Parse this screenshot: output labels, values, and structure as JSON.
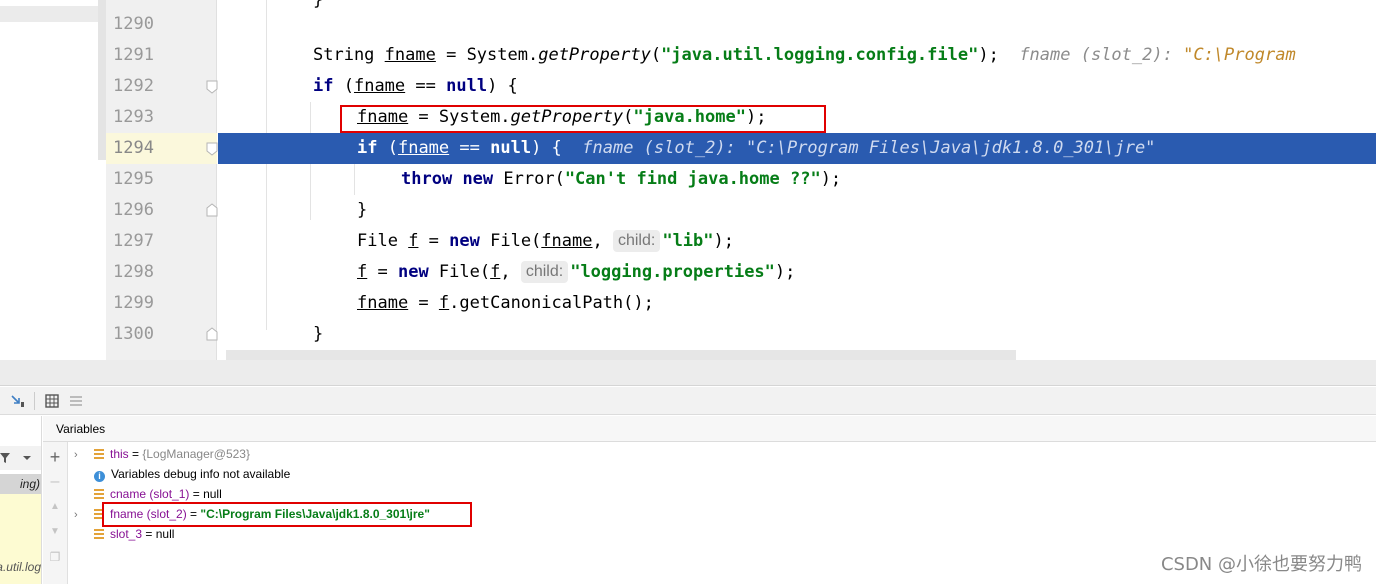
{
  "editor": {
    "line_numbers": [
      "1290",
      "1291",
      "1292",
      "1293",
      "1294",
      "1295",
      "1296",
      "1297",
      "1298",
      "1299",
      "1300"
    ],
    "current_line": "1294",
    "code": {
      "l1290": "}",
      "l1291_type": "String",
      "l1291_var": "fname",
      "l1291_eq": " = System.",
      "l1291_method": "getProperty",
      "l1291_open": "(",
      "l1291_str": "\"java.util.logging.config.file\"",
      "l1291_close": ");",
      "l1291_hint_name": "fname (slot_2):",
      "l1291_hint_val": "\"C:\\Program",
      "l1292_if": "if",
      "l1292_a": " (",
      "l1292_var": "fname",
      "l1292_b": " == ",
      "l1292_null": "null",
      "l1292_c": ") {",
      "l1293_var": "fname",
      "l1293_eq": " = System.",
      "l1293_method": "getProperty",
      "l1293_open": "(",
      "l1293_str": "\"java.home\"",
      "l1293_close": ");",
      "l1294_if": "if",
      "l1294_a": " (",
      "l1294_var": "fname",
      "l1294_b": " == ",
      "l1294_null": "null",
      "l1294_c": ") {",
      "l1294_hint": "fname (slot_2): \"C:\\Program Files\\Java\\jdk1.8.0_301\\jre\"",
      "l1295_throw": "throw",
      "l1295_new": "new",
      "l1295_a": " Error(",
      "l1295_str": "\"Can't find java.home ??\"",
      "l1295_close": ");",
      "l1296": "}",
      "l1297_type": "File ",
      "l1297_var": "f",
      "l1297_eq": " = ",
      "l1297_new": "new",
      "l1297_a": " File(",
      "l1297_arg": "fname",
      "l1297_comma": ", ",
      "l1297_param": "child:",
      "l1297_str": "\"lib\"",
      "l1297_close": ");",
      "l1298_var": "f",
      "l1298_eq": " = ",
      "l1298_new": "new",
      "l1298_a": " File(",
      "l1298_arg": "f",
      "l1298_comma": ", ",
      "l1298_param": "child:",
      "l1298_str": "\"logging.properties\"",
      "l1298_close": ");",
      "l1299_var": "fname",
      "l1299_eq": " = ",
      "l1299_arg": "f",
      "l1299_rest": ".getCanonicalPath();",
      "l1300": "}"
    },
    "frames_partial": {
      "selected": "ing)",
      "bottom": "a.util.log"
    }
  },
  "debugger": {
    "variables_tab": "Variables",
    "variables": [
      {
        "name": "this",
        "sep": " = ",
        "value": "{LogManager@523}",
        "expandable": true
      },
      {
        "info": "Variables debug info not available"
      },
      {
        "name": "cname (slot_1)",
        "sep": " = ",
        "value": "null"
      },
      {
        "name": "fname (slot_2)",
        "sep": " = ",
        "value": "\"C:\\Program Files\\Java\\jdk1.8.0_301\\jre\"",
        "expandable": true
      },
      {
        "name": "slot_3",
        "sep": " = ",
        "value": "null"
      }
    ]
  },
  "watermark": "CSDN @小徐也要努力鸭",
  "colors": {
    "execution_line": "#2a5bb0",
    "keyword": "#000080",
    "string": "#067d17",
    "highlight_box": "#e00000"
  }
}
